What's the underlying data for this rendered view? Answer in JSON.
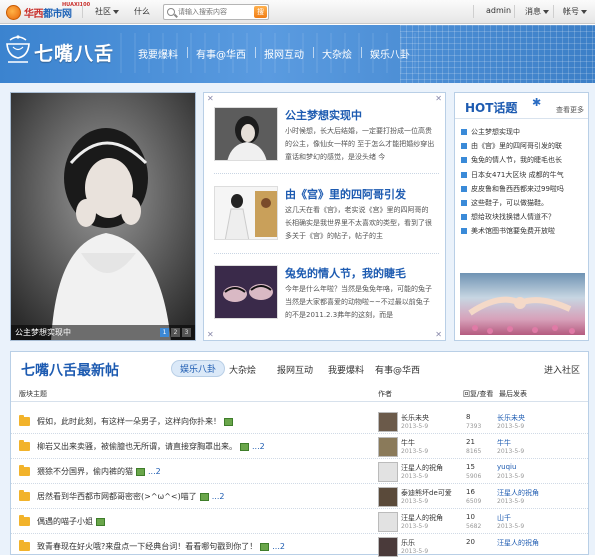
{
  "topbar": {
    "logo_text_a": "华西",
    "logo_text_b": "都市网",
    "logo_sub": "HUAXI100",
    "nav_community": "社区",
    "nav_what": "什么",
    "search_placeholder": "请输入搜索内容",
    "search_button": "搜",
    "user": "admin",
    "messages": "消息",
    "account": "帐号"
  },
  "banner": {
    "title": "七嘴八舌",
    "nav": [
      "我要爆料",
      "有事@华西",
      "报网互动",
      "大杂烩",
      "娱乐八卦"
    ]
  },
  "photo": {
    "caption": "公主梦想实现中",
    "dots": [
      "1",
      "2",
      "3"
    ]
  },
  "stories": [
    {
      "title": "公主梦想实现中",
      "body": "小时候想，长大后结婚，一定要打扮成一位高贵的公主，像仙女一样的 至于怎么才能把婚纱穿出童话和梦幻的感觉，是没头绪 今"
    },
    {
      "title": "由《宫》里的四阿哥引发",
      "body": "这几天在看《宫》，老实说《宫》里的四阿哥的长相确实是我世界里不太喜欢的类型，看到了很多关于《宫》的帖子，帖子的主"
    },
    {
      "title": "兔免的情人节，我的睫毛",
      "body": "今年是什么年啦？当然是兔免年咯，可能的兔子当然是大家都喜爱的动物啦~~不过最以前兔子的不是2011.2.3弗年的这刻，而是"
    }
  ],
  "hot": {
    "title": "HOT话题",
    "more": "查看更多",
    "items": [
      "公主梦想实现中",
      "由《宫》里的四阿哥引发的联",
      "兔免的情人节，我的睫毛也长",
      "日本女471大区块 成都的牛气",
      "皮皮鲁和鲁西西都来过99啦吗",
      "这些鞋子，可以做猫鞋。",
      "想给玫块找换错人情道不？",
      "美术馆图书馆要免费开放啦"
    ]
  },
  "latest": {
    "title": "七嘴八舌最新帖",
    "tabs": [
      "娱乐八卦",
      "大杂烩",
      "报网互动",
      "我要爆料",
      "有事@华西"
    ],
    "enter": "进入社区",
    "header": {
      "topic": "版块主题",
      "author": "作者",
      "replies": "回复/查看",
      "last": "最后发表"
    },
    "rows": [
      {
        "title": "假如，此时此刻，有这样一朵男子，这样向你扑来！",
        "pages": "",
        "author": "长乐未央",
        "date": "2013-5-9",
        "replies": "8",
        "views": "7393",
        "last": "长乐未央",
        "last_date": "2013-5-9"
      },
      {
        "title": "柳岩又出来卖骚，被偷臆也无所谓，请直接穿胸罩出来。",
        "pages": "...2",
        "author": "牛牛",
        "date": "2013-5-9",
        "replies": "21",
        "views": "8165",
        "last": "牛牛",
        "last_date": "2013-5-9"
      },
      {
        "title": "猥狳不分国界，偷内裤的猫",
        "pages": "...2",
        "author": "汪星人的祝角",
        "date": "2013-5-9",
        "replies": "15",
        "views": "5906",
        "last": "yuqiu",
        "last_date": "2013-5-9"
      },
      {
        "title": "居然看到华西都市网都哥密密(>^ω^<)喵了",
        "pages": "...2",
        "author": "泰迪熊坏de可爱",
        "date": "2013-5-9",
        "replies": "16",
        "views": "6509",
        "last": "汪星人的祝角",
        "last_date": "2013-5-9"
      },
      {
        "title": "偶遇的喵子小姐",
        "pages": "",
        "author": "汪星人的祝角",
        "date": "2013-5-9",
        "replies": "10",
        "views": "5682",
        "last": "山千",
        "last_date": "2013-5-9"
      },
      {
        "title": "致青春现在好火哦?来盘点一下经典台词！看看哪句戳到你了！",
        "pages": "...2",
        "author": "乐乐",
        "date": "2013-5-9",
        "replies": "20",
        "views": "",
        "last": "汪星人的祝角",
        "last_date": "2013-5-9"
      }
    ]
  }
}
